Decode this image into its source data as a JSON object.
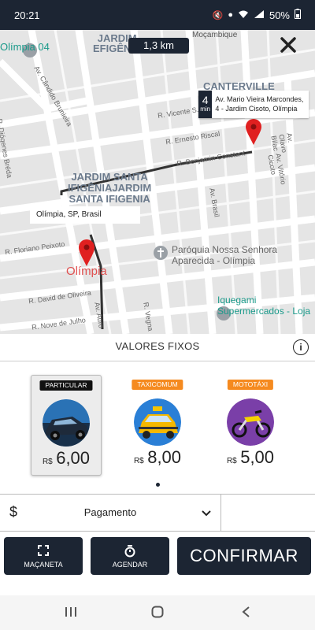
{
  "status_bar": {
    "time": "20:21",
    "battery": "50%"
  },
  "map": {
    "distance": "1,3 km",
    "eta": {
      "minutes": "4",
      "unit": "min",
      "address": "Av. Mario Vieira Marcondes, 4 - Jardim Cisoto, Olímpia"
    },
    "origin": "Olímpia, SP, Brasil",
    "labels": {
      "jardim_efigenia_1": "JARDIM",
      "jardim_efigenia_2": "EFIGÊNIA",
      "canterville": "CANTERVILLE",
      "jardim_santa_1": "JARDIM SANTA",
      "jardim_santa_2": "IFIGÊNIAJARDIM",
      "jardim_santa_3": "SANTA IFIGENIA",
      "olimpia_city": "Olímpia",
      "paroquia_1": "Paróquia Nossa Senhora",
      "paroquia_2": "Aparecida - Olímpia",
      "iquegami_1": "Iquegami",
      "iquegami_2": "Supermercados - Loja",
      "olimpia_04": "Olímpia 04",
      "mocambique": "Moçambique",
      "street_candido": "Av. Cândido Brunieira",
      "street_vicente": "R. Vicente S.",
      "street_ernesto": "R. Ernesto Riscal",
      "street_benjamin": "R. Benjamin Constant",
      "street_diogenes": "R. Diógenes Bréda",
      "street_brasil": "Av. Brasil",
      "street_floriano": "R. Floriano Peixoto",
      "street_david": "R. David de Oliveira",
      "street_julho": "R. Nove de Julho",
      "street_aurora": "Av. Auro",
      "street_vegna": "R. Vegna",
      "street_olavo": "Av. Olavo Bilac",
      "street_vitorio": "Av. Vitório Cicoto"
    }
  },
  "section": {
    "title": "VALORES FIXOS",
    "info_icon": "info-icon"
  },
  "options": [
    {
      "badge": "PARTICULAR",
      "badge_color": "#111111",
      "currency": "R$",
      "price": "6,00",
      "selected": true,
      "icon": "car-icon"
    },
    {
      "badge": "TAXICOMUM",
      "badge_color": "#f58a1f",
      "currency": "R$",
      "price": "8,00",
      "selected": false,
      "icon": "taxi-icon"
    },
    {
      "badge": "MOTOTÁXI",
      "badge_color": "#f58a1f",
      "currency": "R$",
      "price": "5,00",
      "selected": false,
      "icon": "motorcycle-icon"
    }
  ],
  "payment": {
    "symbol": "$",
    "label": "Pagamento"
  },
  "actions": {
    "macaneta": "MAÇANETA",
    "agendar": "AGENDAR",
    "confirm": "CONFIRMAR"
  },
  "colors": {
    "dark": "#1c2533",
    "orange": "#f58a1f",
    "pin": "#e02020"
  }
}
